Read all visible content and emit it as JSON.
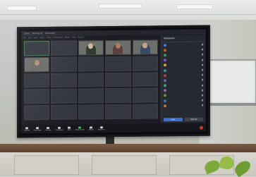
{
  "colors": {
    "screen_bg": "#1b1d22",
    "tile_bg": "#34373f",
    "panel_bg": "#262930",
    "end_button": "#d9302c",
    "participant_avatar_colors": [
      "#3f7bd9",
      "#c35e2b",
      "#3a9b5c",
      "#8a4fbf",
      "#d1a32a",
      "#2f8fa8",
      "#b8434a",
      "#5d6ea8",
      "#4a9a7a",
      "#a65f9a",
      "#6f8f3a",
      "#3c72b5",
      "#c0712d"
    ]
  },
  "window": {
    "title_items": [
      "Zoom",
      "Meeting ID",
      "Recording"
    ],
    "menu_items": [
      "File",
      "Edit",
      "View",
      "Audio",
      "Video",
      "Participants",
      "Share",
      "Chat",
      "Record"
    ]
  },
  "gallery": {
    "tiles": [
      {
        "label": "",
        "video": false
      },
      {
        "label": "",
        "video": false
      },
      {
        "label": "",
        "video": true
      },
      {
        "label": "",
        "video": true
      },
      {
        "label": "",
        "video": true
      },
      {
        "label": "",
        "video": true
      },
      {
        "label": "",
        "video": false
      },
      {
        "label": "",
        "video": false
      },
      {
        "label": "",
        "video": false
      },
      {
        "label": "",
        "video": false
      },
      {
        "label": "",
        "video": false
      },
      {
        "label": "",
        "video": false
      },
      {
        "label": "",
        "video": false
      },
      {
        "label": "",
        "video": false
      },
      {
        "label": "",
        "video": false
      },
      {
        "label": "",
        "video": false
      },
      {
        "label": "",
        "video": false
      },
      {
        "label": "",
        "video": false
      },
      {
        "label": "",
        "video": false
      },
      {
        "label": "",
        "video": false
      },
      {
        "label": "",
        "video": false
      },
      {
        "label": "",
        "video": false
      },
      {
        "label": "",
        "video": false
      },
      {
        "label": "",
        "video": false
      },
      {
        "label": "",
        "video": false
      }
    ]
  },
  "participants_panel": {
    "title": "Participants",
    "items": [
      "",
      "",
      "",
      "",
      "",
      "",
      "",
      "",
      "",
      "",
      "",
      "",
      ""
    ],
    "invite_label": "Invite",
    "mute_label": "Mute All"
  },
  "toolbar": {
    "buttons": [
      "Unmute",
      "Start Video",
      "Security",
      "Participants",
      "Chat",
      "Share Screen",
      "Record",
      "Reactions"
    ],
    "end_label": "End"
  }
}
